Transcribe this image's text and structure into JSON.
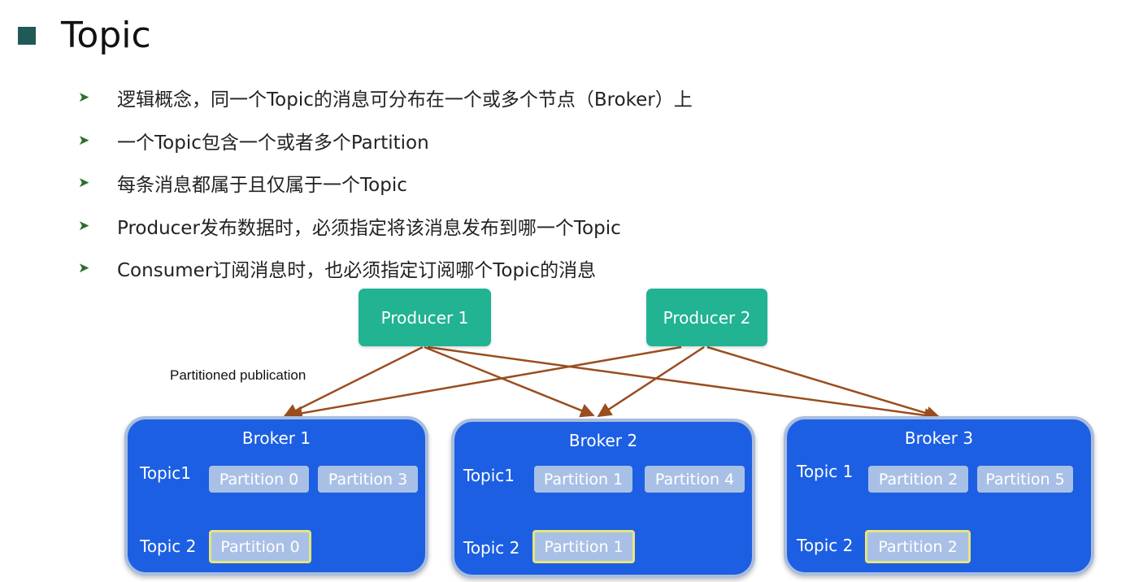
{
  "title": "Topic",
  "bullets": [
    "逻辑概念，同一个Topic的消息可分布在一个或多个节点（Broker）上",
    "一个Topic包含一个或者多个Partition",
    "每条消息都属于且仅属于一个Topic",
    "Producer发布数据时，必须指定将该消息发布到哪一个Topic",
    "Consumer订阅消息时，也必须指定订阅哪个Topic的消息"
  ],
  "producers": [
    "Producer 1",
    "Producer 2"
  ],
  "publication_label": "Partitioned publication",
  "brokers": [
    {
      "name": "Broker 1",
      "topic1_label": "Topic1",
      "topic1_partitions": [
        "Partition 0",
        "Partition 3"
      ],
      "topic2_label": "Topic 2",
      "topic2_partition": "Partition 0"
    },
    {
      "name": "Broker 2",
      "topic1_label": "Topic1",
      "topic1_partitions": [
        "Partition 1",
        "Partition 4"
      ],
      "topic2_label": "Topic 2",
      "topic2_partition": "Partition 1"
    },
    {
      "name": "Broker 3",
      "topic1_label": "Topic 1",
      "topic1_partitions": [
        "Partition 2",
        "Partition 5"
      ],
      "topic2_label": "Topic 2",
      "topic2_partition": "Partition 2"
    }
  ],
  "colors": {
    "title_marker": "#1f5a57",
    "producer": "#21b392",
    "broker": "#1c5fe2",
    "partition": "#a9c0e6",
    "highlight_border": "#e7e57b",
    "arrow": "#9a4d1e"
  }
}
